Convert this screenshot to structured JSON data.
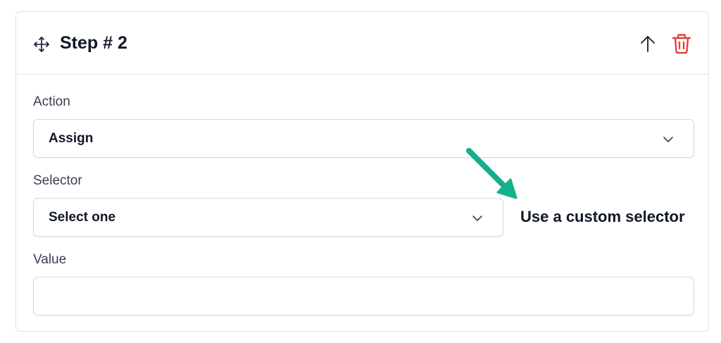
{
  "step": {
    "title": "Step # 2"
  },
  "icons": {
    "move": "move-icon",
    "up": "arrow-up-icon",
    "delete": "trash-icon",
    "chevron": "chevron-down-icon",
    "annotation_arrow": "arrow-down-right-icon"
  },
  "fields": {
    "action": {
      "label": "Action",
      "value": "Assign"
    },
    "selector": {
      "label": "Selector",
      "value": "Select one"
    },
    "value": {
      "label": "Value",
      "value": "",
      "placeholder": ""
    }
  },
  "annotation": {
    "text": "Use a custom selector"
  },
  "colors": {
    "delete": "#e53e3e",
    "annotation_arrow": "#14b08e",
    "border": "#e3e5e8",
    "text": "#111827",
    "label": "#374151"
  }
}
